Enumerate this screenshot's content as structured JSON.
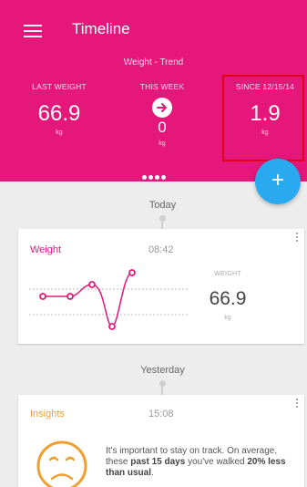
{
  "header": {
    "menu_icon": "hamburger-icon",
    "title": "Timeline",
    "trend_title": "Weight - Trend",
    "background_color": "#e6177a",
    "stats": {
      "last_weight": {
        "label": "LAST WEIGHT",
        "value": "66.9",
        "unit": "kg"
      },
      "this_week": {
        "label": "THIS WEEK",
        "icon": "arrow-right-icon",
        "value": "0",
        "unit": "kg"
      },
      "since": {
        "label": "SINCE 12/15/14",
        "value": "1.9",
        "unit": "kg"
      }
    },
    "pager": {
      "page_count": 4
    }
  },
  "fab": {
    "label": "+",
    "icon": "plus-icon",
    "color": "#29aaf0"
  },
  "timeline": {
    "today_label": "Today",
    "yesterday_label": "Yesterday"
  },
  "weight_card": {
    "title": "Weight",
    "time": "08:42",
    "side_label": "WEIGHT",
    "value": "66.9",
    "unit": "kg",
    "accent_color": "#e6177a",
    "trend_points": [
      66.9,
      66.9,
      67.2,
      63.8,
      67.8
    ]
  },
  "insights_card": {
    "title": "Insights",
    "time": "15:08",
    "icon": "sad-face-icon",
    "accent_color": "#f0a030",
    "text_intro": "It's important to stay on track. On average, these ",
    "text_days": "past 15 days",
    "text_mid": " you've walked ",
    "text_less": "20% less than usual",
    "text_end": "."
  }
}
